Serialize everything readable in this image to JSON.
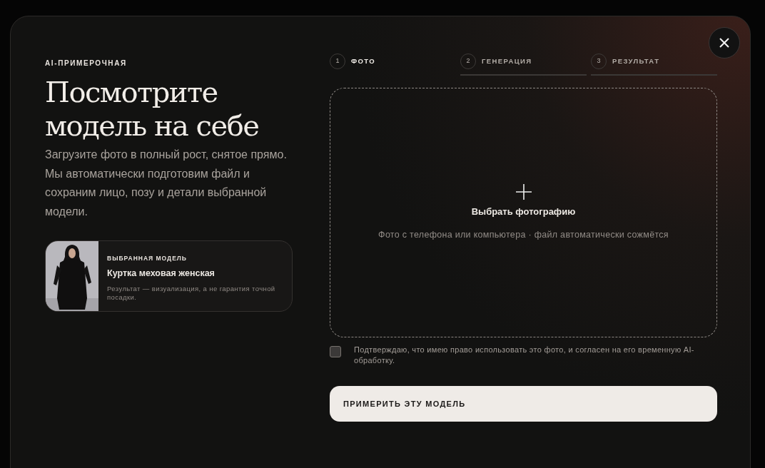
{
  "eyebrow": "AI-ПРИМЕРОЧНАЯ",
  "title": "Посмотрите модель на себе",
  "description": "Загрузите фото в полный рост, снятое прямо. Мы автоматически подготовим файл и сохраним лицо, позу и детали выбранной модели.",
  "selected_model": {
    "kind": "picture",
    "label": "ВЫБРАННАЯ МОДЕЛЬ",
    "name": "Куртка меховая женская",
    "note": "Результат — визуализация, а не гарантия точной посадки."
  },
  "steps": [
    {
      "number": "1",
      "label": "ФОТО",
      "selected": true
    },
    {
      "number": "2",
      "label": "ГЕНЕРАЦИЯ",
      "selected": false
    },
    {
      "number": "3",
      "label": "РЕЗУЛЬТАТ",
      "selected": false
    }
  ],
  "upload": {
    "title": "Выбрать фотографию",
    "hint": "Фото с телефона или компьютера · файл автоматически сожмётся"
  },
  "consent": {
    "text": "Подтверждаю, что имею право использовать это фото, и согласен на его временную AI-обработку.",
    "checked": false
  },
  "submit_button": "ПРИМЕРИТЬ ЭТУ МОДЕЛЬ"
}
